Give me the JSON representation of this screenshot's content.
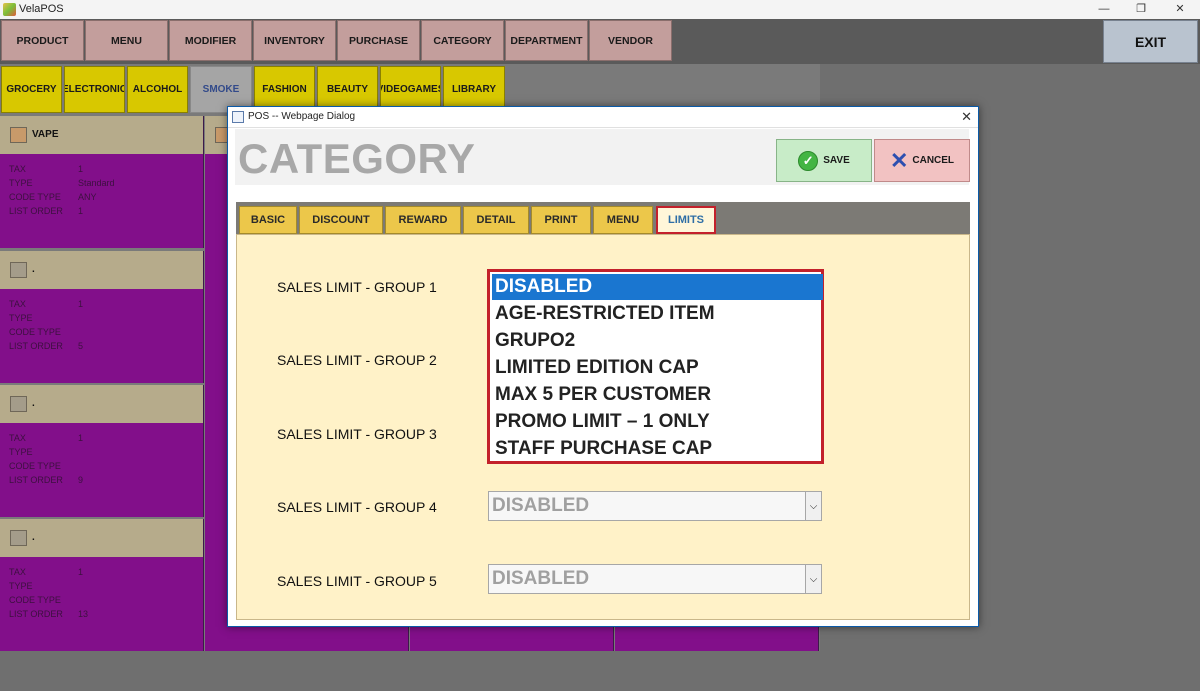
{
  "window": {
    "title": "VelaPOS",
    "minimize": "—",
    "restore": "❐",
    "close": "✕"
  },
  "nav": {
    "items": [
      "PRODUCT",
      "MENU",
      "MODIFIER",
      "INVENTORY",
      "PURCHASE",
      "CATEGORY",
      "DEPARTMENT",
      "VENDOR"
    ],
    "exit": "EXIT"
  },
  "subtabs": {
    "items": [
      "GROCERY",
      "ELECTRONIC",
      "ALCOHOL",
      "SMOKE",
      "FASHION",
      "BEAUTY",
      "VIDEOGAMES",
      "LIBRARY"
    ],
    "active": "SMOKE"
  },
  "cards": {
    "field_labels": [
      "TAX",
      "TYPE",
      "CODE TYPE",
      "LIST ORDER"
    ],
    "items": [
      {
        "name": "VAPE",
        "tax": "1",
        "type": "Standard",
        "code_type": "ANY",
        "list_order": "1"
      },
      {
        "name": ".",
        "tax": "1",
        "type": "",
        "code_type": "",
        "list_order": "5"
      },
      {
        "name": ".",
        "tax": "1",
        "type": "",
        "code_type": "",
        "list_order": "9"
      },
      {
        "name": ".",
        "tax": "1",
        "type": "",
        "code_type": "",
        "list_order": "13"
      }
    ]
  },
  "dialog": {
    "title": "POS -- Webpage Dialog",
    "close": "✕",
    "heading": "CATEGORY",
    "save_label": "SAVE",
    "cancel_label": "CANCEL",
    "tabs": [
      "BASIC",
      "DISCOUNT",
      "REWARD",
      "DETAIL",
      "PRINT",
      "MENU",
      "LIMITS"
    ],
    "active_tab": "LIMITS",
    "labels": [
      "SALES LIMIT - GROUP 1",
      "SALES LIMIT - GROUP 2",
      "SALES LIMIT - GROUP 3",
      "SALES LIMIT - GROUP 4",
      "SALES LIMIT - GROUP 5"
    ],
    "list_options": [
      "DISABLED",
      "AGE-RESTRICTED ITEM",
      "GRUPO2",
      "LIMITED EDITION CAP",
      "MAX 5 PER CUSTOMER",
      "PROMO LIMIT – 1 ONLY",
      "STAFF PURCHASE CAP"
    ],
    "list_selected": "DISABLED",
    "group4_value": "DISABLED",
    "group5_value": "DISABLED"
  },
  "colors": {
    "accent_selection": "#1a76d0",
    "highlight_border": "#c3212b"
  }
}
